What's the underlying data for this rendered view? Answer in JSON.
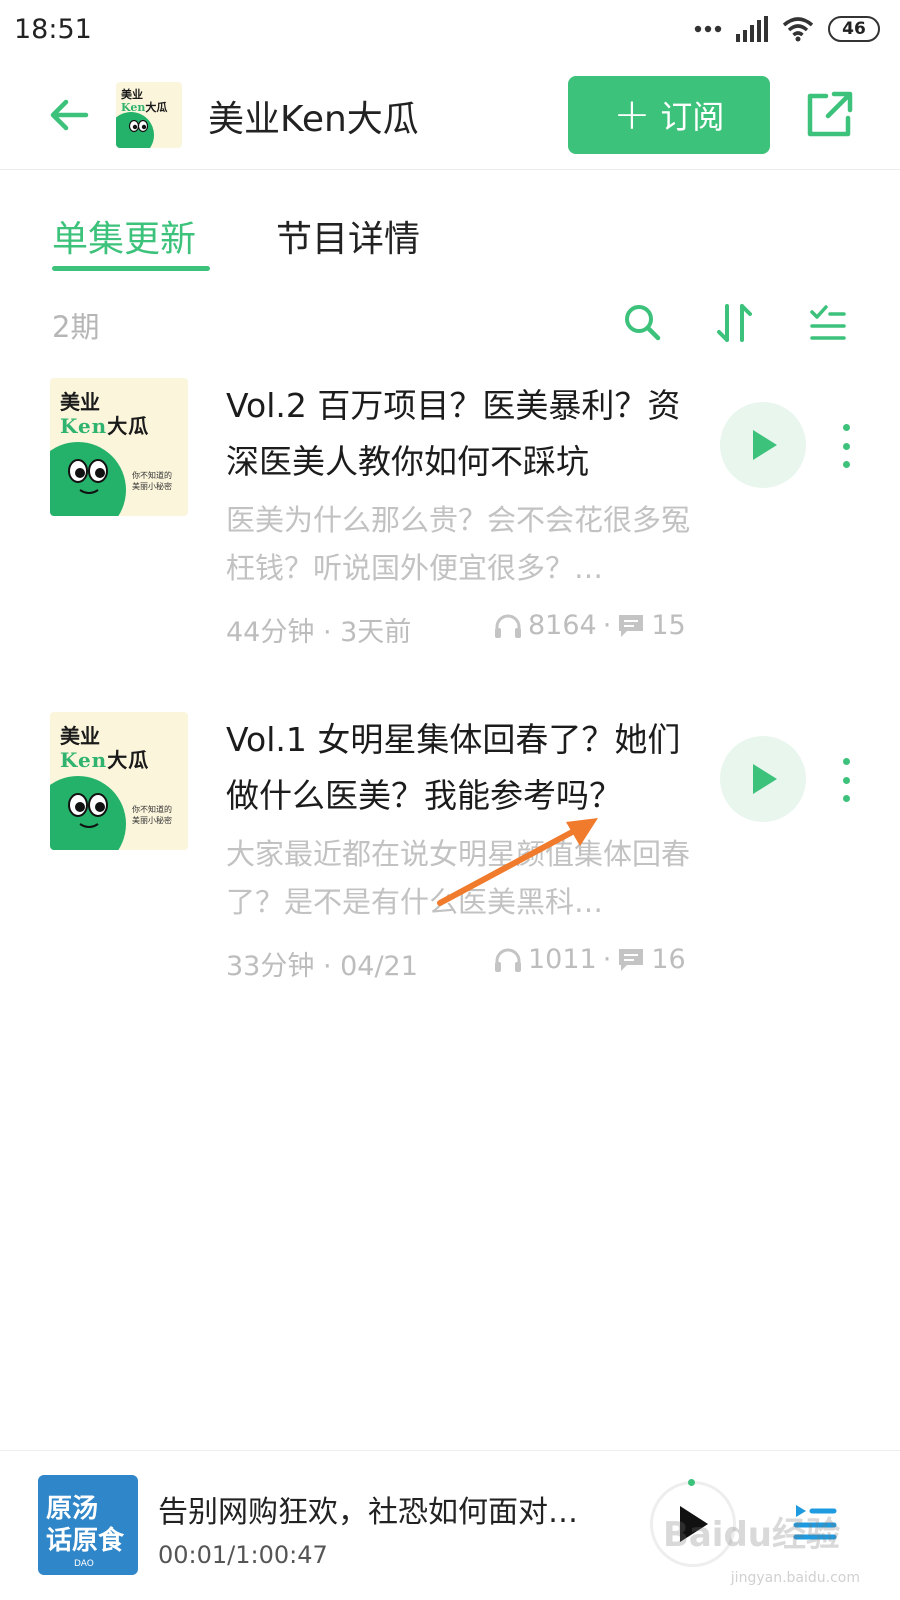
{
  "status_bar": {
    "time": "18:51",
    "battery": "46"
  },
  "header": {
    "title": "美业Ken大瓜",
    "subscribe_label": "订阅"
  },
  "cover_art": {
    "line1": "美业",
    "ken": "Ken",
    "dagua": "大瓜",
    "tagline1": "你不知道的",
    "tagline2": "美丽小秘密"
  },
  "tabs": [
    {
      "label": "单集更新",
      "active": true
    },
    {
      "label": "节目详情",
      "active": false
    }
  ],
  "episode_count": "2期",
  "episodes": [
    {
      "title": "Vol.2 百万项目？医美暴利？资深医美人教你如何不踩坑",
      "description": "医美为什么那么贵？会不会花很多冤枉钱？听说国外便宜很多？…",
      "duration_date": "44分钟 · 3天前",
      "plays": "8164",
      "comments": "15"
    },
    {
      "title": "Vol.1 女明星集体回春了？她们做什么医美？我能参考吗？",
      "description": "大家最近都在说女明星颜值集体回春了？是不是有什么医美黑科…",
      "duration_date": "33分钟 · 04/21",
      "plays": "1011",
      "comments": "16"
    }
  ],
  "mini_player": {
    "title": "告别网购狂欢，社恐如何面对…",
    "time": "00:01/1:00:47",
    "cover_text_line1": "原汤",
    "cover_text_line2": "话原食",
    "cover_tag": "DAO"
  },
  "watermark": {
    "brand": "Baidu经验",
    "url": "jingyan.baidu.com"
  },
  "colors": {
    "accent": "#3cc27a",
    "annotation_arrow": "#f07b2c"
  }
}
